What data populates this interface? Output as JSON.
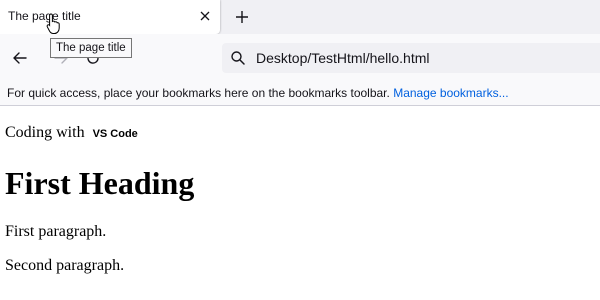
{
  "browser": {
    "tab": {
      "title": "The page title",
      "close_icon": "close-icon"
    },
    "new_tab_icon": "plus-icon",
    "tooltip": "The page title",
    "nav": {
      "back_icon": "arrow-left-icon",
      "forward_icon": "arrow-right-icon",
      "reload_icon": "reload-icon"
    },
    "urlbar": {
      "search_icon": "search-icon",
      "url": "Desktop/TestHtml/hello.html"
    },
    "bookmarks": {
      "message": "For quick access, place your bookmarks here on the bookmarks toolbar.",
      "manage_link": "Manage bookmarks..."
    },
    "colors": {
      "tabstrip": "#f0f0f4",
      "toolbar": "#f9f9fb",
      "link": "#0060df"
    }
  },
  "page": {
    "intro_text": "Coding with",
    "intro_code": "VS Code",
    "heading": "First Heading",
    "paragraphs": [
      "First paragraph.",
      "Second paragraph."
    ]
  }
}
